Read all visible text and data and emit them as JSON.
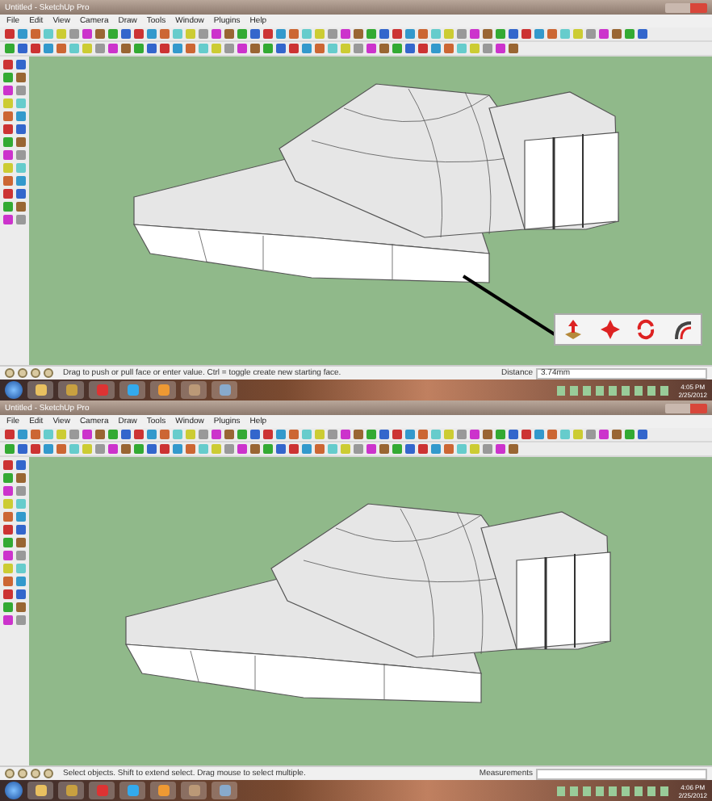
{
  "windows": [
    {
      "title": "Untitled - SketchUp Pro",
      "menu": [
        "File",
        "Edit",
        "View",
        "Camera",
        "Draw",
        "Tools",
        "Window",
        "Plugins",
        "Help"
      ],
      "status": {
        "message": "Drag to push or pull face or enter value.  Ctrl = toggle create new starting face.",
        "measurement_label": "Distance",
        "measurement_value": "3.74mm"
      },
      "tool_popup": [
        {
          "kind": "pushpull"
        },
        {
          "kind": "move"
        },
        {
          "kind": "rotate"
        },
        {
          "kind": "followme"
        }
      ],
      "taskbar": {
        "time": "4:05 PM",
        "date": "2/25/2012"
      }
    },
    {
      "title": "Untitled - SketchUp Pro",
      "menu": [
        "File",
        "Edit",
        "View",
        "Camera",
        "Draw",
        "Tools",
        "Window",
        "Plugins",
        "Help"
      ],
      "status": {
        "message": "Select objects. Shift to extend select. Drag mouse to select multiple.",
        "measurement_label": "Measurements"
      },
      "taskbar": {
        "time": "4:06 PM",
        "date": "2/25/2012"
      }
    }
  ]
}
